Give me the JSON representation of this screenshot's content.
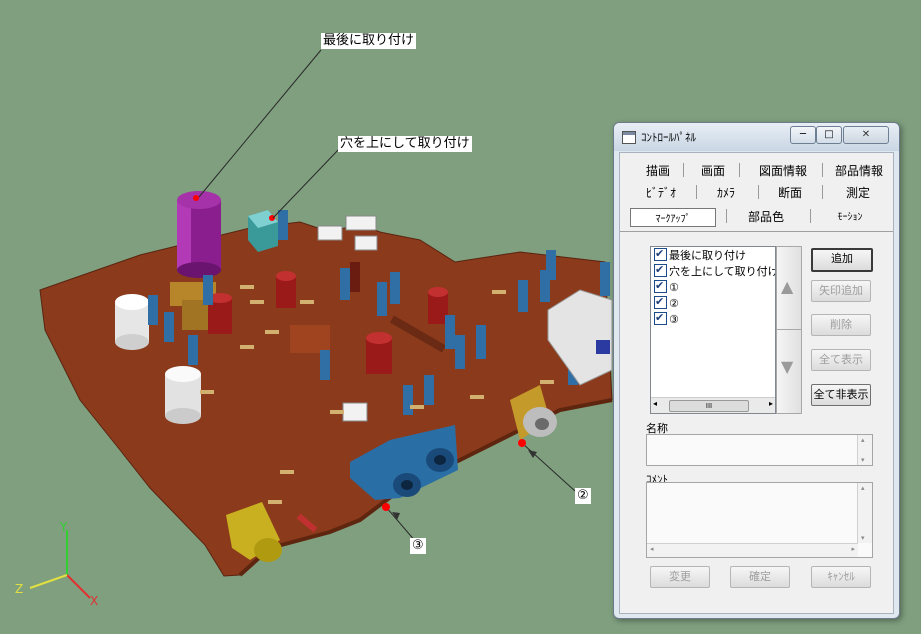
{
  "scene": {
    "callouts": {
      "last_mount": "最後に取り付け",
      "hole_up": "穴を上にして取り付け",
      "mark2": "②",
      "mark3": "③"
    },
    "axes": {
      "x": "X",
      "y": "Y",
      "z": "Z"
    },
    "colors": {
      "background": "#7f9f7f",
      "board": "#8e3a1a",
      "marker": "#ff0000"
    }
  },
  "panel": {
    "title": "ｺﾝﾄﾛｰﾙﾊﾟﾈﾙ",
    "window_buttons": {
      "minimize": "─",
      "maximize": "□",
      "close": "✕"
    },
    "tabs": {
      "row1": [
        "描画",
        "画面",
        "図面情報",
        "部品情報"
      ],
      "row2": [
        "ﾋﾞﾃﾞｵ",
        "ｶﾒﾗ",
        "断面",
        "測定"
      ],
      "row3": [
        "ﾏｰｸｱｯﾌﾟ",
        "部品色",
        "ﾓｰｼｮﾝ"
      ]
    },
    "list_items": [
      "最後に取り付け",
      "穴を上にして取り付け",
      "①",
      "②",
      "③"
    ],
    "list_scroll": {
      "left": "◂",
      "right": "▸",
      "thumb": "III"
    },
    "updown": {
      "up": "▲",
      "down": "▼"
    },
    "buttons": {
      "add": "追加",
      "add_arrow": "矢印追加",
      "delete": "削除",
      "show_all": "全て表示",
      "hide_all": "全て非表示",
      "change": "変更",
      "confirm": "確定",
      "cancel": "ｷｬﾝｾﾙ"
    },
    "labels": {
      "name": "名称",
      "comment": "ｺﾒﾝﾄ"
    },
    "scroll_glyphs": {
      "up": "▴",
      "down": "▾",
      "left": "◂",
      "right": "▸"
    }
  }
}
